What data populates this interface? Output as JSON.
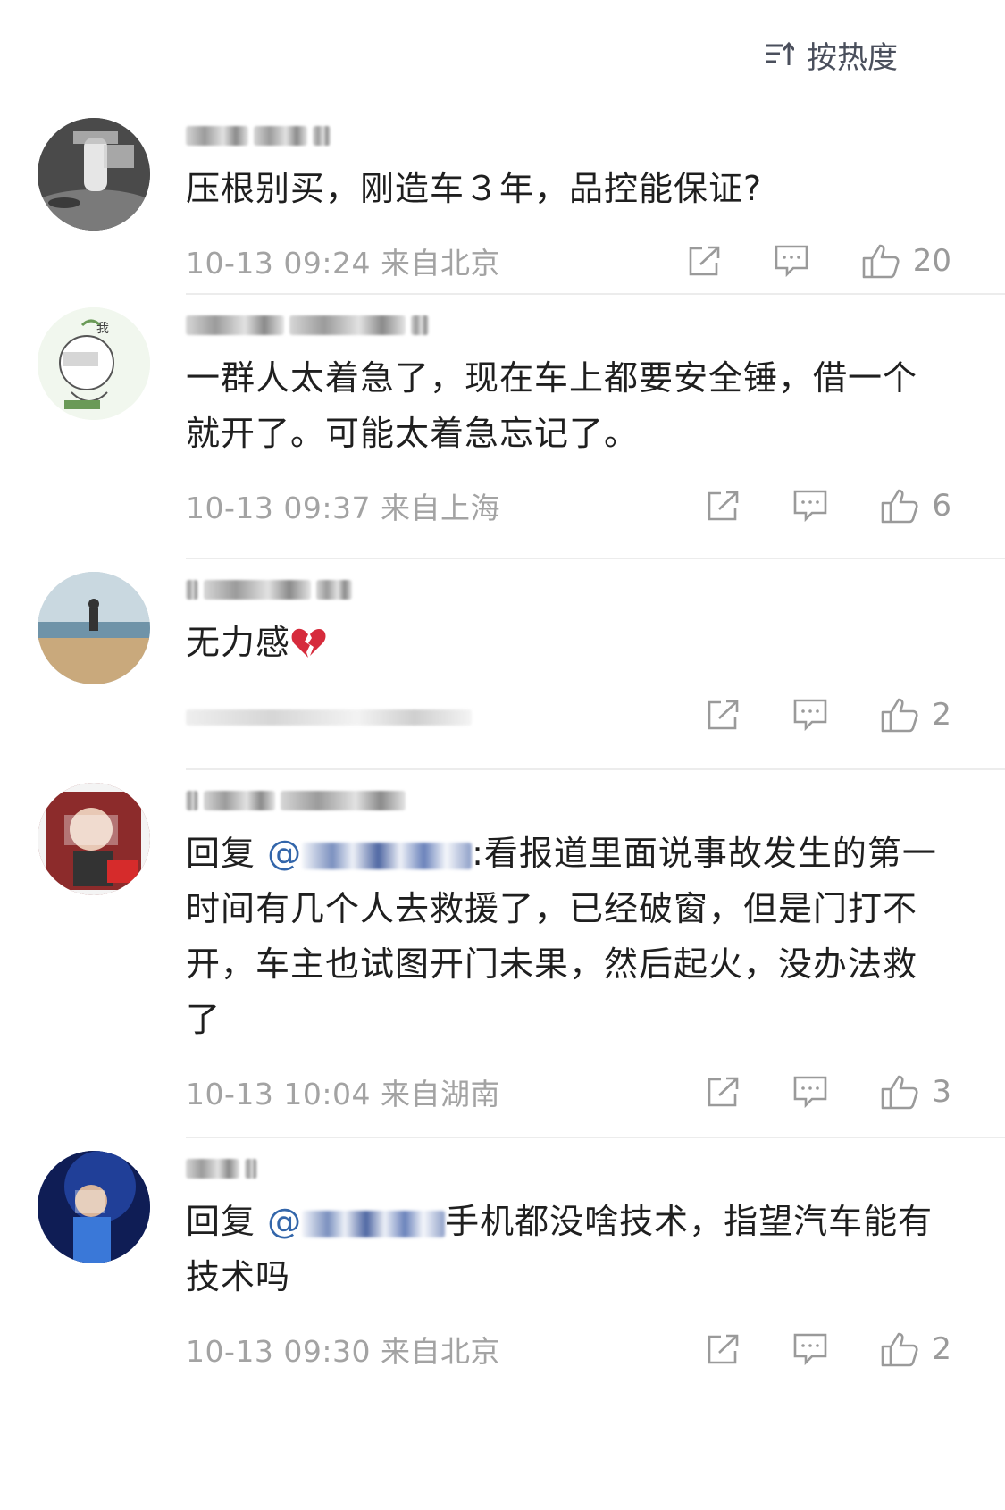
{
  "sort": {
    "label": "按热度"
  },
  "comments": [
    {
      "text": "压根别买，刚造车３年，品控能保证?",
      "time": "10-13 09:24",
      "location": "来自北京",
      "likes": "20",
      "avatar": {
        "bg": "#5b5b5b",
        "accent": "#d0d0d0"
      }
    },
    {
      "text": "一群人太着急了，现在车上都要安全锤，借一个就开了。可能太着急忘记了。",
      "time": "10-13 09:37",
      "location": "来自上海",
      "likes": "6",
      "avatar": {
        "bg": "#eef5ea",
        "accent": "#6a9a57"
      }
    },
    {
      "text": "无力感",
      "emoji": "broken-heart",
      "time": "",
      "location": "",
      "likes": "2",
      "avatar": {
        "bg": "#b9c7cf",
        "accent": "#c9a97c"
      }
    },
    {
      "reply_prefix": "回复",
      "mention": "@",
      "text": ":看报道里面说事故发生的第一时间有几个人去救援了，已经破窗，但是门打不开，车主也试图开门未果，然后起火，没办法救了",
      "time": "10-13 10:04",
      "location": "来自湖南",
      "likes": "3",
      "avatar": {
        "bg": "#8c2b2b",
        "accent": "#e8c8b5"
      }
    },
    {
      "reply_prefix": "回复",
      "mention": "@",
      "text": "手机都没啥技术，指望汽车能有技术吗",
      "time": "10-13 09:30",
      "location": "来自北京",
      "likes": "2",
      "avatar": {
        "bg": "#1b2f7a",
        "accent": "#3a78d8"
      }
    }
  ]
}
